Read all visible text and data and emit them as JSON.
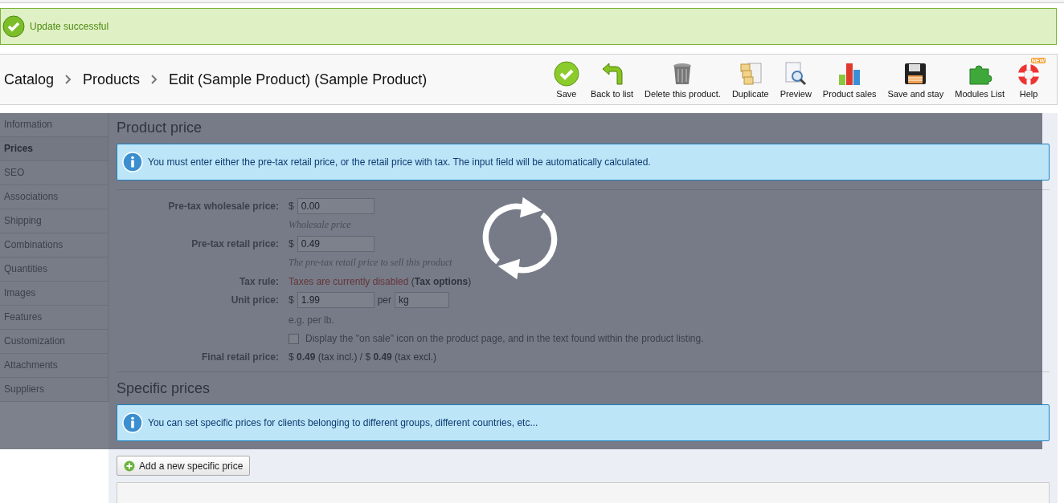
{
  "notice": {
    "text": "Update successful"
  },
  "breadcrumb": [
    "Catalog",
    "Products",
    "Edit (Sample Product) (Sample Product)"
  ],
  "toolbar": [
    {
      "kind": "save",
      "label": "Save"
    },
    {
      "kind": "back",
      "label": "Back to list"
    },
    {
      "kind": "delete",
      "label": "Delete this product."
    },
    {
      "kind": "duplicate",
      "label": "Duplicate"
    },
    {
      "kind": "preview",
      "label": "Preview"
    },
    {
      "kind": "sales",
      "label": "Product sales"
    },
    {
      "kind": "stay",
      "label": "Save and stay"
    },
    {
      "kind": "modules",
      "label": "Modules List"
    },
    {
      "kind": "help",
      "label": "Help",
      "badge": "NEW"
    }
  ],
  "sidebar": {
    "items": [
      {
        "label": "Information",
        "selected": false
      },
      {
        "label": "Prices",
        "selected": true
      },
      {
        "label": "SEO",
        "selected": false
      },
      {
        "label": "Associations",
        "selected": false
      },
      {
        "label": "Shipping",
        "selected": false
      },
      {
        "label": "Combinations",
        "selected": false
      },
      {
        "label": "Quantities",
        "selected": false
      },
      {
        "label": "Images",
        "selected": false
      },
      {
        "label": "Features",
        "selected": false
      },
      {
        "label": "Customization",
        "selected": false
      },
      {
        "label": "Attachments",
        "selected": false
      },
      {
        "label": "Suppliers",
        "selected": false
      }
    ]
  },
  "product_price": {
    "title": "Product price",
    "info": "You must enter either the pre-tax retail price, or the retail price with tax. The input field will be automatically calculated.",
    "rows": [
      {
        "kind": "input",
        "label": "Pre-tax wholesale price:",
        "currency": "$",
        "value": "0.00",
        "hint": "Wholesale price"
      },
      {
        "kind": "input",
        "label": "Pre-tax retail price:",
        "currency": "$",
        "value": "0.49",
        "hint": "The pre-tax retail price to sell this product"
      },
      {
        "kind": "tax",
        "label": "Tax rule:",
        "warning": "Taxes are currently disabled",
        "link": "(**Tax options**)"
      },
      {
        "kind": "unit",
        "label": "Unit price:",
        "currency": "$",
        "value": "1.99",
        "per": "per",
        "unit": "kg",
        "hint": "e.g. per lb."
      },
      {
        "kind": "checkbox",
        "checked": false,
        "text": "Display the \"on sale\" icon on the product page, and in the text found within the product listing."
      },
      {
        "kind": "final",
        "label": "Final retail price:",
        "text": "$ **0.49** (tax incl.) / $ **0.49** (tax excl.)"
      }
    ]
  },
  "specific_prices": {
    "title": "Specific prices",
    "info": "You can set specific prices for clients belonging to different groups, different countries, etc...",
    "button": "Add a new specific price"
  },
  "loading": {
    "visible": true
  }
}
